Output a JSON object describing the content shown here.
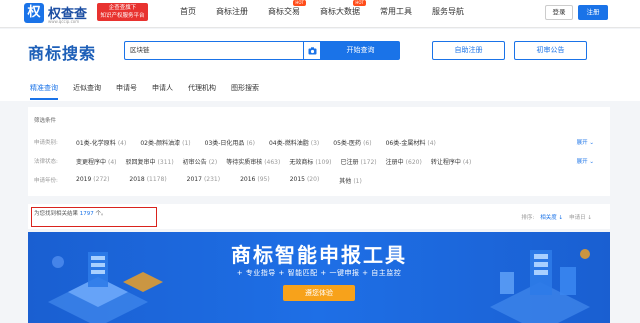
{
  "brand": {
    "logo_char": "权",
    "name": "权查查",
    "url": "www.qccip.com",
    "slogan_line1": "企查查旗下",
    "slogan_line2": "知识产权服务平台"
  },
  "nav": {
    "items": [
      "首页",
      "商标注册",
      "商标交易",
      "商标大数据",
      "常用工具",
      "服务导航"
    ],
    "hot_badge": "HOT",
    "login": "登录",
    "register": "注册"
  },
  "header": {
    "title": "商标搜索",
    "search_value": "区块链",
    "search_button": "开始查询",
    "self_register": "自助注册",
    "notice": "初审公告"
  },
  "tabs": [
    "精准查询",
    "近似查询",
    "申请号",
    "申请人",
    "代理机构",
    "图形搜索"
  ],
  "filters": {
    "title": "筛选条件",
    "rows": [
      {
        "label": "申请类别:",
        "options": [
          {
            "name": "01类-化学原料",
            "count": "(4)"
          },
          {
            "name": "02类-颜料油漆",
            "count": "(1)"
          },
          {
            "name": "03类-日化用品",
            "count": "(6)"
          },
          {
            "name": "04类-燃料油脂",
            "count": "(3)"
          },
          {
            "name": "05类-医药",
            "count": "(6)"
          },
          {
            "name": "06类-金属材料",
            "count": "(4)"
          }
        ],
        "more": "展开"
      },
      {
        "label": "法律状态:",
        "options": [
          {
            "name": "变更程序中",
            "count": "(4)"
          },
          {
            "name": "驳回复审中",
            "count": "(311)"
          },
          {
            "name": "初审公告",
            "count": "(2)"
          },
          {
            "name": "等待实质审核",
            "count": "(463)"
          },
          {
            "name": "无效商标",
            "count": "(109)"
          },
          {
            "name": "已注册",
            "count": "(172)"
          },
          {
            "name": "注册中",
            "count": "(620)"
          },
          {
            "name": "转让程序中",
            "count": "(4)"
          }
        ],
        "more": "展开"
      },
      {
        "label": "申请年份:",
        "options": [
          {
            "name": "2019",
            "count": "(272)"
          },
          {
            "name": "2018",
            "count": "(1178)"
          },
          {
            "name": "2017",
            "count": "(231)"
          },
          {
            "name": "2016",
            "count": "(95)"
          },
          {
            "name": "2015",
            "count": "(20)"
          },
          {
            "name": "其他",
            "count": "(1)"
          }
        ],
        "more": ""
      }
    ]
  },
  "results": {
    "prefix": "为您找到相关结果",
    "count": "1797",
    "suffix": "个。",
    "sort_label": "排序:",
    "sort_relevance": "相关度 ↓",
    "sort_date": "申请日 ↓"
  },
  "banner": {
    "title": "商标智能申报工具",
    "features": "+ 专业指导   + 智能匹配   + 一键申报   + 自主监控",
    "cta": "遵您体验"
  },
  "colors": {
    "primary": "#1a73e8",
    "title_blue": "#1d5fb8",
    "red": "#d9231d",
    "cta_orange": "#f7a21b"
  }
}
